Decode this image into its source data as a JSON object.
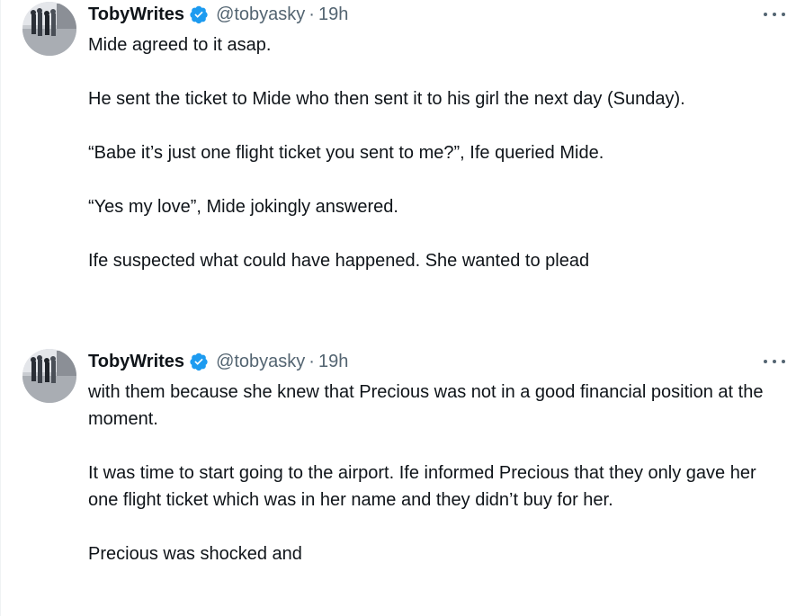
{
  "tweets": [
    {
      "author": {
        "name": "TobyWrites",
        "handle": "@tobyasky",
        "verified": true,
        "time": "19h",
        "separator": "·"
      },
      "paragraphs": [
        "Mide agreed to it asap.",
        "He sent the ticket to Mide who then sent it to his girl the next day (Sunday).",
        "“Babe it’s just one flight ticket you sent to me?”, Ife queried Mide.",
        "“Yes my love”, Mide jokingly answered.",
        "Ife suspected what could have happened. She wanted to plead"
      ]
    },
    {
      "author": {
        "name": "TobyWrites",
        "handle": "@tobyasky",
        "verified": true,
        "time": "19h",
        "separator": "·"
      },
      "paragraphs": [
        "with them because she knew that Precious was not in a good financial position at the moment.",
        "It was time to start going to the airport. Ife informed Precious that they only gave her one flight ticket which was in her name and they didn’t buy for her.",
        "Precious was shocked and"
      ]
    }
  ],
  "icons": {
    "verified": "verified-badge-icon",
    "more": "more-options-icon"
  },
  "colors": {
    "text_primary": "#0f1419",
    "text_secondary": "#536471",
    "verified_blue": "#1d9bf0",
    "divider": "#eff3f4"
  }
}
